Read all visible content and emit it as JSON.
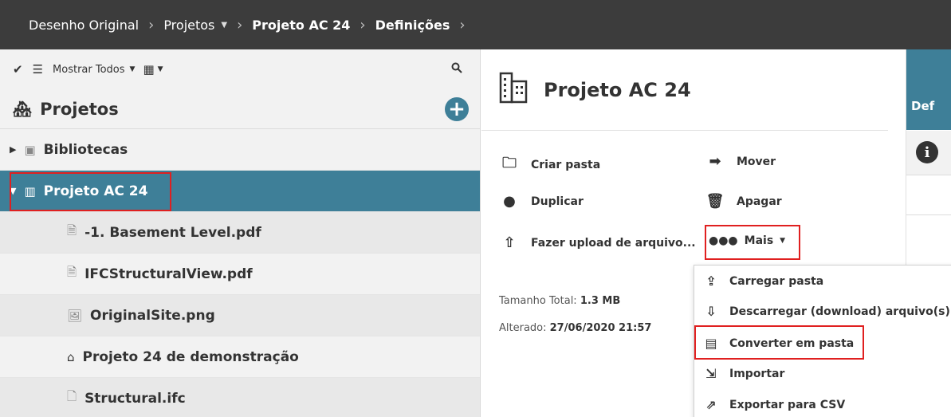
{
  "breadcrumb": {
    "items": [
      "Desenho Original",
      "Projetos",
      "Projeto AC 24",
      "Definições"
    ],
    "separator": ">"
  },
  "toolbar": {
    "filter_label": "Mostrar Todos"
  },
  "tree": {
    "header": "Projetos",
    "items": [
      {
        "label": "Bibliotecas",
        "icon": "library-icon"
      },
      {
        "label": "Projeto AC 24",
        "icon": "building-icon"
      },
      {
        "label": "-1. Basement Level.pdf",
        "icon": "pdf-file-icon"
      },
      {
        "label": "IFCStructuralView.pdf",
        "icon": "pdf-file-icon"
      },
      {
        "label": "OriginalSite.png",
        "icon": "image-file-icon"
      },
      {
        "label": "Projeto 24 de demonstração",
        "icon": "project-icon"
      },
      {
        "label": "Structural.ifc",
        "icon": "file-icon"
      }
    ]
  },
  "details": {
    "title": "Projeto AC 24",
    "actions": {
      "create_folder": "Criar pasta",
      "move": "Mover",
      "duplicate": "Duplicar",
      "delete": "Apagar",
      "upload": "Fazer upload de arquivo...",
      "more": "Mais"
    },
    "size_label": "Tamanho Total:",
    "size_value": "1.3 MB",
    "modified_label": "Alterado:",
    "modified_value": "27/06/2020 21:57"
  },
  "menu": {
    "items": [
      "Carregar pasta",
      "Descarregar (download) arquivo(s)",
      "Converter em pasta",
      "Importar",
      "Exportar para CSV"
    ]
  },
  "right_panel": {
    "tab_label": "Def"
  },
  "colors": {
    "topbar": "#3c3c3c",
    "accent": "#3e7f98",
    "highlight": "#e02020"
  }
}
